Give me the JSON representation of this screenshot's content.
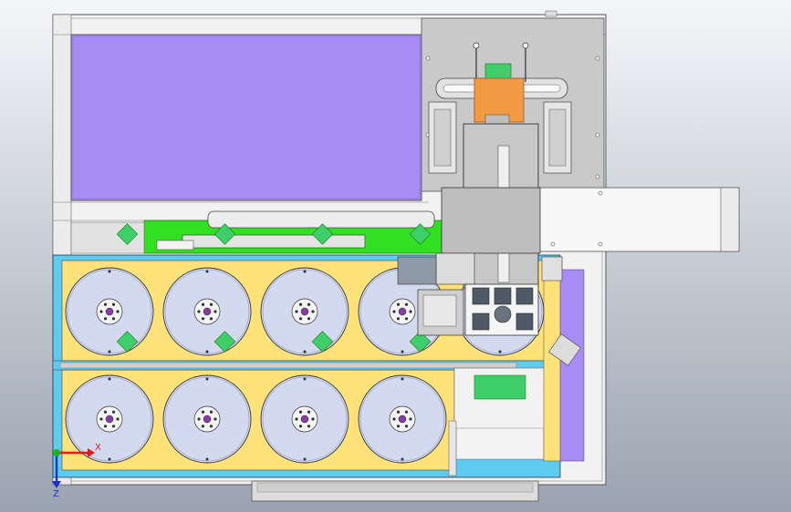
{
  "view": {
    "type": "CAD top view of machine assembly",
    "colors": {
      "background_top": "#f4f6f9",
      "background_bottom": "#9aa3b0",
      "frame": "#f2f2f2",
      "frame_edge": "#555555",
      "purple_panel": "#a88bf5",
      "plate_gray": "#c9c9c9",
      "tray_yellow": "#ffe27a",
      "tray_blue": "#5ecbf1",
      "green": "#33e021",
      "diamond_green": "#3ecf6a",
      "reel": "#d3d9ef",
      "hub_purple": "#8a3aa8",
      "orange": "#f29b45",
      "rail_gray": "#bfbfbf"
    }
  },
  "reels": {
    "top_row_count": 5,
    "bottom_row_count": 4
  },
  "triad": {
    "x_label": "X",
    "z_label": "Z",
    "x_color": "#e41b1b",
    "y_color": "#1bb51b",
    "z_color": "#1b2fd6"
  }
}
